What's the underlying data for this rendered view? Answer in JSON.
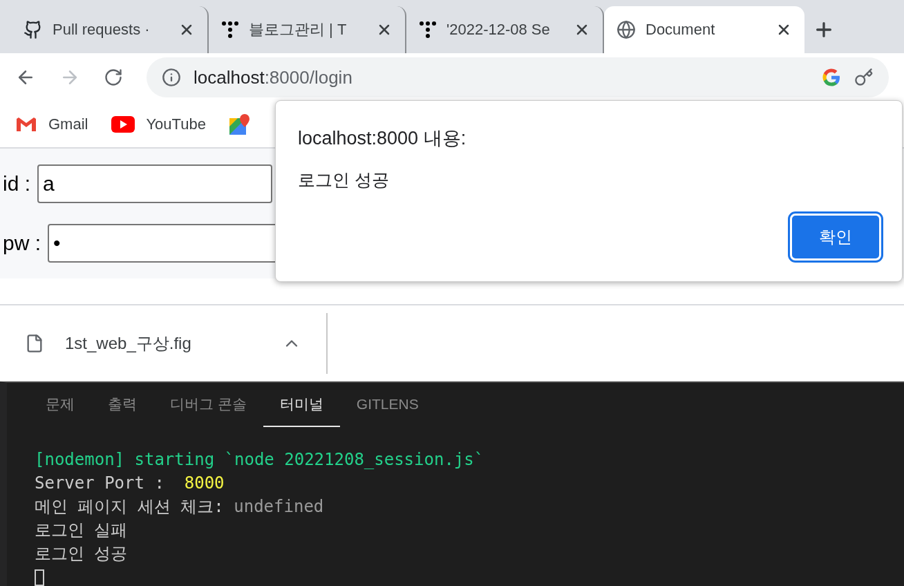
{
  "tabs": [
    {
      "title": "Pull requests ·",
      "kind": "github",
      "selected": false
    },
    {
      "title": "블로그관리 | T",
      "kind": "dots",
      "selected": false
    },
    {
      "title": "'2022-12-08 Se",
      "kind": "dots",
      "selected": false
    },
    {
      "title": "Document",
      "kind": "globe",
      "selected": true
    }
  ],
  "address": {
    "host": "localhost",
    "rest": ":8000/login"
  },
  "bookmarks": [
    {
      "label": "Gmail",
      "kind": "gmail"
    },
    {
      "label": "YouTube",
      "kind": "youtube"
    },
    {
      "kind": "maps"
    }
  ],
  "form": {
    "fields": [
      {
        "label": "id :",
        "value": "a"
      },
      {
        "label": "pw :",
        "value": "•"
      }
    ]
  },
  "dialog": {
    "title": "localhost:8000 내용:",
    "message": "로그인 성공",
    "button": "확인"
  },
  "download": {
    "filename": "1st_web_구상.fig"
  },
  "panel_tabs": [
    {
      "label": "문제",
      "selected": false
    },
    {
      "label": "출력",
      "selected": false
    },
    {
      "label": "디버그 콘솔",
      "selected": false
    },
    {
      "label": "터미널",
      "selected": true
    },
    {
      "label": "GITLENS",
      "selected": false
    }
  ],
  "terminal": [
    [
      {
        "text": "[nodemon] starting `node 20221208_session.js`",
        "kind": "green"
      }
    ],
    [
      {
        "text": "Server Port :  ",
        "kind": "plain"
      },
      {
        "text": "8000",
        "kind": "yellow"
      }
    ],
    [
      {
        "text": "메인 페이지 세션 체크: ",
        "kind": "plain"
      },
      {
        "text": "undefined",
        "kind": "gray"
      }
    ],
    [
      {
        "text": "로그인 실패",
        "kind": "plain"
      }
    ],
    [
      {
        "text": "로그인 성공",
        "kind": "plain"
      }
    ]
  ]
}
